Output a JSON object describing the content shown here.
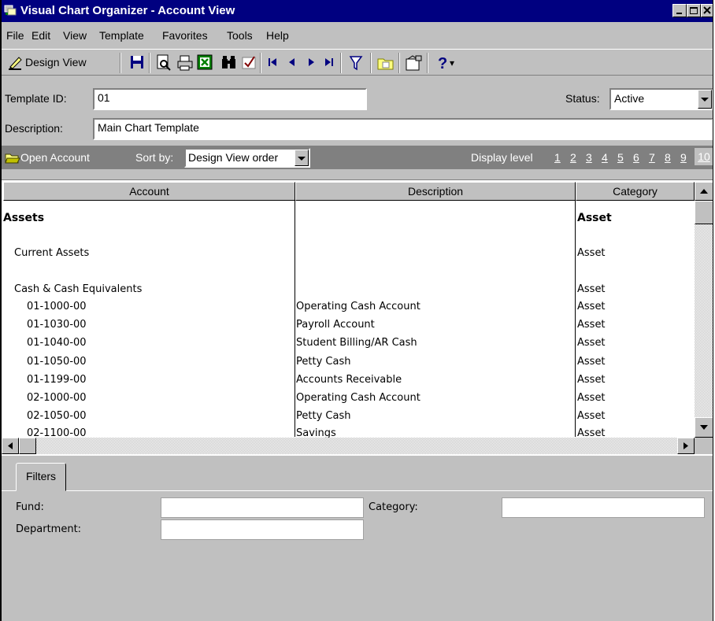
{
  "window": {
    "title": "Visual Chart Organizer - Account View"
  },
  "menu": [
    "File",
    "Edit",
    "View",
    "Template",
    "Favorites",
    "Tools",
    "Help"
  ],
  "toolbar": {
    "design_view_label": "Design View"
  },
  "form": {
    "template_id_label": "Template ID:",
    "template_id_value": "01",
    "status_label": "Status:",
    "status_value": "Active",
    "description_label": "Description:",
    "description_value": "Main Chart Template"
  },
  "accountbar": {
    "open_account_label": "Open Account",
    "sort_by_label": "Sort by:",
    "sort_by_value": "Design View order",
    "display_level_label": "Display level",
    "levels": [
      "1",
      "2",
      "3",
      "4",
      "5",
      "6",
      "7",
      "8",
      "9",
      "10"
    ],
    "selected_level": "10"
  },
  "grid": {
    "columns": [
      "Account",
      "Description",
      "Category"
    ],
    "rows": [
      {
        "account": "Assets",
        "description": "",
        "category": "Asset",
        "bold": true
      },
      {
        "account": "Current Assets",
        "description": "",
        "category": "Asset"
      },
      {
        "account": "Cash & Cash Equivalents",
        "description": "",
        "category": "Asset"
      },
      {
        "account": "01-1000-00",
        "description": "Operating Cash Account",
        "category": "Asset"
      },
      {
        "account": "01-1030-00",
        "description": "Payroll Account",
        "category": "Asset"
      },
      {
        "account": "01-1040-00",
        "description": "Student Billing/AR Cash",
        "category": "Asset"
      },
      {
        "account": "01-1050-00",
        "description": "Petty Cash",
        "category": "Asset"
      },
      {
        "account": "01-1199-00",
        "description": "Accounts Receivable",
        "category": "Asset"
      },
      {
        "account": "02-1000-00",
        "description": "Operating Cash Account",
        "category": "Asset"
      },
      {
        "account": "02-1050-00",
        "description": "Petty Cash",
        "category": "Asset"
      },
      {
        "account": "02-1100-00",
        "description": "Savings",
        "category": "Asset"
      }
    ]
  },
  "filters": {
    "tab_label": "Filters",
    "fund_label": "Fund:",
    "category_label": "Category:",
    "department_label": "Department:"
  },
  "colors": {
    "titlebar": "#000080",
    "face": "#c0c0c0",
    "darkbar": "#808080"
  }
}
